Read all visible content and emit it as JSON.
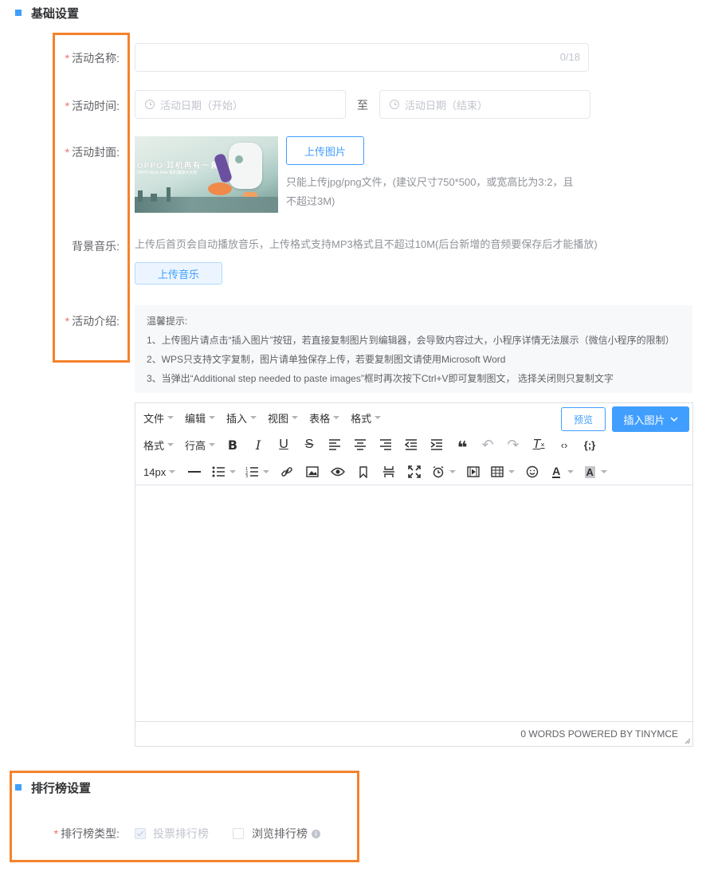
{
  "basic_section": {
    "title": "基础设置"
  },
  "activity_name": {
    "label": "活动名称:",
    "required_mark": "*",
    "value": "",
    "counter": "0/18"
  },
  "activity_time": {
    "label": "活动时间:",
    "required_mark": "*",
    "start_placeholder": "活动日期（开始）",
    "separator": "至",
    "end_placeholder": "活动日期（结束）"
  },
  "activity_cover": {
    "label": "活动封面:",
    "required_mark": "*",
    "image_text": "OPPO 耳机再有一套",
    "image_subtext": "OPPO Enco Free 真机播放计大奖",
    "upload_button": "上传图片",
    "hint_line1": "只能上传jpg/png文件，(建议尺寸750*500，或宽高比为3:2，且",
    "hint_line2": "不超过3M)"
  },
  "background_music": {
    "label": "背景音乐:",
    "hint": "上传后首页会自动播放音乐，上传格式支持MP3格式且不超过10M(后台新增的音频要保存后才能播放)",
    "upload_button": "上传音乐"
  },
  "activity_intro": {
    "label": "活动介绍:",
    "required_mark": "*",
    "tips_title": "温馨提示:",
    "tips": [
      "1、上传图片请点击“插入图片”按钮，若直接复制图片到编辑器，会导致内容过大，小程序详情无法展示（微信小程序的限制）",
      "2、WPS只支持文字复制，图片请单独保存上传，若要复制图文请使用Microsoft Word",
      "3、当弹出“Additional step needed to paste images”框时再次按下Ctrl+V即可复制图文，  选择关闭则只复制文字"
    ]
  },
  "editor": {
    "menus": [
      "文件",
      "编辑",
      "插入",
      "视图",
      "表格",
      "格式"
    ],
    "preview_button": "预览",
    "insert_image_button": "插入图片",
    "format_label": "格式",
    "line_height_label": "行高",
    "font_size": "14px",
    "status_text": "0 WORDS POWERED BY TINYMCE"
  },
  "ranking_section": {
    "title": "排行榜设置",
    "type_label": "排行榜类型:",
    "required_mark": "*",
    "options": [
      {
        "label": "投票排行榜",
        "checked": true,
        "disabled": true
      },
      {
        "label": "浏览排行榜",
        "checked": false,
        "disabled": false
      }
    ]
  },
  "colors": {
    "accent": "#409eff",
    "required": "#f56c6c",
    "highlight_box": "#f5822b"
  }
}
